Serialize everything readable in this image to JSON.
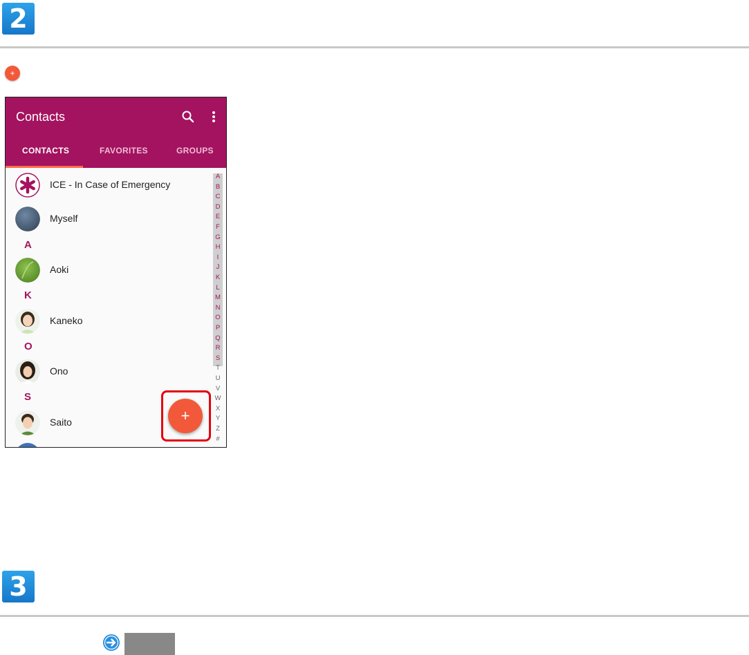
{
  "steps": [
    {
      "number": "2"
    },
    {
      "number": "3"
    }
  ],
  "mini_fab_symbol": "+",
  "app": {
    "title": "Contacts",
    "tabs": [
      {
        "label": "CONTACTS",
        "selected": true
      },
      {
        "label": "FAVORITES",
        "selected": false
      },
      {
        "label": "GROUPS",
        "selected": false
      }
    ],
    "icons": [
      "search-icon",
      "more-vert-icon"
    ],
    "colors": {
      "appbar": "#a3135f",
      "accent": "#ff6a4c",
      "fab": "#f2593a",
      "section_letter": "#a3135f"
    }
  },
  "contacts": [
    {
      "name": "ICE - In Case of Emergency"
    },
    {
      "name": "Myself"
    },
    {
      "section": "A"
    },
    {
      "name": "Aoki"
    },
    {
      "section": "K"
    },
    {
      "name": "Kaneko"
    },
    {
      "section": "O"
    },
    {
      "name": "Ono"
    },
    {
      "section": "S"
    },
    {
      "name": "Saito"
    }
  ],
  "index_letters": [
    "A",
    "B",
    "C",
    "D",
    "E",
    "F",
    "G",
    "H",
    "I",
    "J",
    "K",
    "L",
    "M",
    "N",
    "O",
    "P",
    "Q",
    "R",
    "S",
    "T",
    "U",
    "V",
    "W",
    "X",
    "Y",
    "Z",
    "#"
  ],
  "fab_symbol": "+",
  "highlight_color": "#e5000e"
}
